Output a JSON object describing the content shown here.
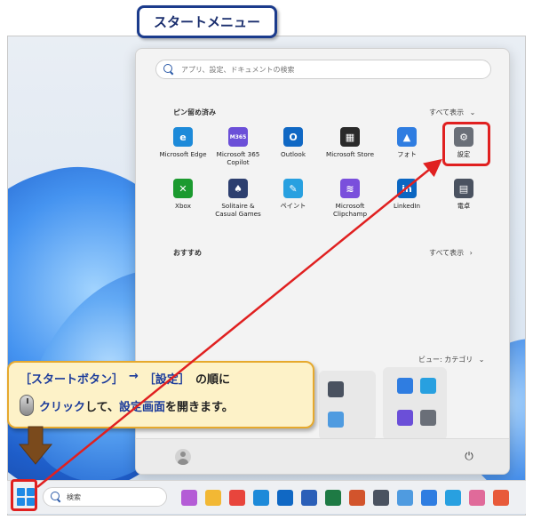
{
  "title": "スタートメニュー",
  "search": {
    "placeholder": "アプリ、設定、ドキュメントの検索"
  },
  "pinned": {
    "title": "ピン留め済み",
    "all_label": "すべて表示",
    "all_chevron": "⌄",
    "apps": [
      {
        "name": "edge",
        "label": "Microsoft Edge",
        "color": "#1d8ad9",
        "glyph": "e"
      },
      {
        "name": "m365",
        "label": "Microsoft 365\nCopilot",
        "color": "#6b4fd8",
        "glyph": "M365"
      },
      {
        "name": "outlook",
        "label": "Outlook",
        "color": "#1068c4",
        "glyph": "O"
      },
      {
        "name": "store",
        "label": "Microsoft Store",
        "color": "#2a2a2a",
        "glyph": "▦"
      },
      {
        "name": "photos",
        "label": "フォト",
        "color": "#2f7de1",
        "glyph": "▲"
      },
      {
        "name": "settings",
        "label": "設定",
        "color": "#6a6f78",
        "glyph": "⚙"
      },
      {
        "name": "xbox",
        "label": "Xbox",
        "color": "#1b9a2f",
        "glyph": "✕"
      },
      {
        "name": "solitaire",
        "label": "Solitaire &\nCasual Games",
        "color": "#2d3f6f",
        "glyph": "♠"
      },
      {
        "name": "paint",
        "label": "ペイント",
        "color": "#28a0e0",
        "glyph": "✎"
      },
      {
        "name": "clipchamp",
        "label": "Microsoft\nClipchamp",
        "color": "#7a4fdc",
        "glyph": "≋"
      },
      {
        "name": "linkedin",
        "label": "LinkedIn",
        "color": "#0a66c2",
        "glyph": "in"
      },
      {
        "name": "calculator",
        "label": "電卓",
        "color": "#4a5260",
        "glyph": "▤"
      }
    ]
  },
  "recommended": {
    "title": "おすすめ",
    "all_label": "すべて表示",
    "all_chevron": "›"
  },
  "all_apps": {
    "view_label": "ビュー: カテゴリ",
    "view_chevron": "⌄"
  },
  "power_glyph": "⏻",
  "callout": {
    "part1": "［スタートボタン］",
    "arrow": "→",
    "part2": "［設定］",
    "part3": "の順に",
    "click": "クリック",
    "rest": "して、",
    "screen": "設定画面",
    "end": "を開きます。"
  },
  "taskbar": {
    "search_label": "検索",
    "apps": [
      {
        "name": "copilot",
        "color": "#b45cd6"
      },
      {
        "name": "explorer",
        "color": "#f2b834"
      },
      {
        "name": "chrome",
        "color": "#e8453c"
      },
      {
        "name": "edge",
        "color": "#1d8ad9"
      },
      {
        "name": "outlook",
        "color": "#1068c4"
      },
      {
        "name": "word",
        "color": "#2b5fb8"
      },
      {
        "name": "excel",
        "color": "#1e7a44"
      },
      {
        "name": "powerpoint",
        "color": "#d2542c"
      },
      {
        "name": "calc",
        "color": "#4a5260"
      },
      {
        "name": "notepad",
        "color": "#4f9be0"
      },
      {
        "name": "photos",
        "color": "#2f7de1"
      },
      {
        "name": "paint",
        "color": "#28a0e0"
      },
      {
        "name": "snipping",
        "color": "#e06a9a"
      },
      {
        "name": "spark",
        "color": "#e85a3a"
      }
    ]
  },
  "colors": {
    "accent_red": "#e02020",
    "callout_bg": "#fdf2c8",
    "callout_text": "#1a3a9a",
    "title_border": "#1b3b8c"
  }
}
